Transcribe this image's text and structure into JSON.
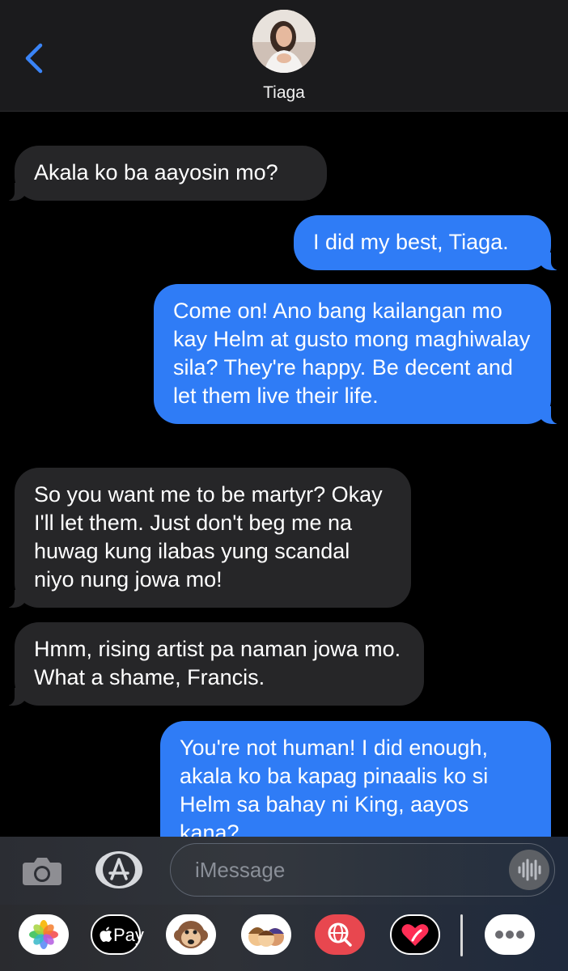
{
  "header": {
    "contact_name": "Tiaga",
    "back_icon": "chevron-left-icon"
  },
  "messages": [
    {
      "direction": "in",
      "text": "Akala ko ba aayosin mo?"
    },
    {
      "direction": "out",
      "text": "I did my best, Tiaga."
    },
    {
      "direction": "out",
      "text": "Come on!  Ano bang kailangan mo kay Helm at gusto mong maghiwalay sila? They're happy. Be decent and let them live their life."
    },
    {
      "direction": "in",
      "text": "So you want me to be martyr? Okay I'll let them. Just don't beg me na huwag kung ilabas yung scandal niyo nung jowa mo!"
    },
    {
      "direction": "in",
      "text": "Hmm, rising artist pa naman jowa mo. What a shame, Francis."
    },
    {
      "direction": "out",
      "text": "You're not human! I did enough, akala ko ba kapag pinaalis ko si Helm sa bahay ni King, aayos kana?"
    }
  ],
  "composer": {
    "placeholder": "iMessage",
    "camera_icon": "camera-icon",
    "appstore_icon": "app-store-icon",
    "audio_icon": "waveform-icon"
  },
  "drawer": {
    "apps": [
      "photos-icon",
      "apple-pay-icon",
      "animoji-monkey-icon",
      "memoji-icon",
      "web-search-icon",
      "digital-touch-icon",
      "more-icon"
    ],
    "apple_pay_label": "Pay"
  },
  "colors": {
    "incoming_bubble": "#262628",
    "outgoing_bubble": "#2f7cf6",
    "accent": "#3a84f7"
  }
}
